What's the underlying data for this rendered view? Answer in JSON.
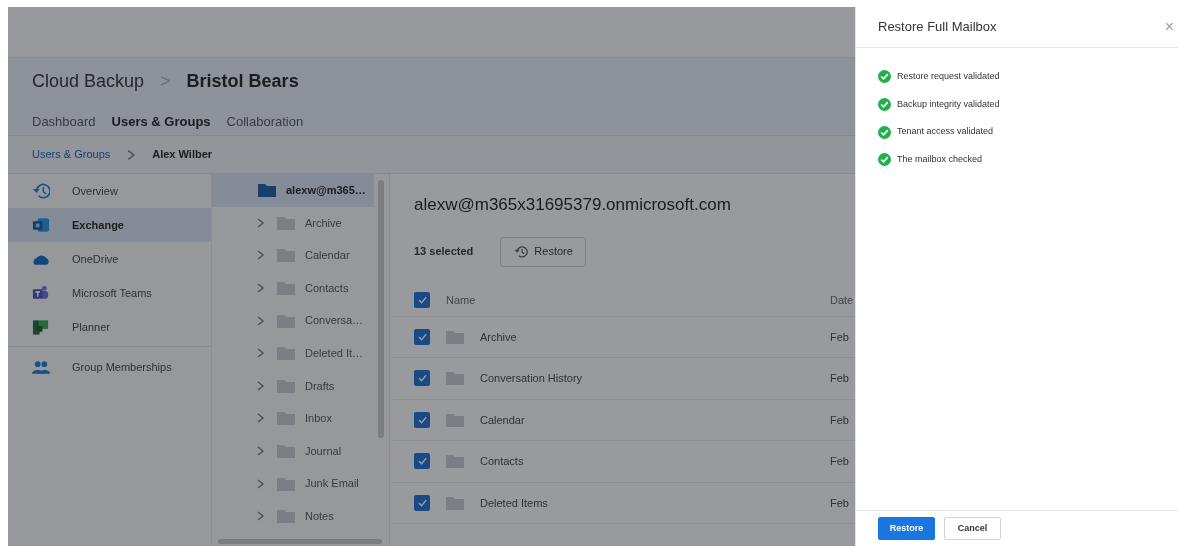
{
  "header": {
    "product": "Cloud Backup",
    "separator": ">",
    "organization": "Bristol Bears"
  },
  "tabs": [
    {
      "label": "Dashboard",
      "selected": false
    },
    {
      "label": "Users & Groups",
      "selected": true
    },
    {
      "label": "Collaboration",
      "selected": false
    }
  ],
  "breadcrumb": [
    {
      "label": "Users & Groups",
      "kind": "link"
    },
    {
      "label": "Alex Wilber",
      "kind": "current"
    }
  ],
  "sidebar": {
    "sections": [
      {
        "items": [
          {
            "label": "Overview",
            "kind": "history",
            "selected": false
          },
          {
            "label": "Exchange",
            "kind": "exchange",
            "selected": true
          },
          {
            "label": "OneDrive",
            "kind": "cloud",
            "selected": false
          },
          {
            "label": "Microsoft Teams",
            "kind": "teams",
            "selected": false
          },
          {
            "label": "Planner",
            "kind": "planner",
            "selected": false
          }
        ]
      },
      {
        "items": [
          {
            "label": "Group Memberships",
            "kind": "people",
            "selected": false
          }
        ]
      }
    ]
  },
  "folder_tree": {
    "root": {
      "label": "alexw@m365…",
      "selected": true
    },
    "children": [
      {
        "label": "Archive",
        "expanded": false
      },
      {
        "label": "Calendar",
        "expanded": false
      },
      {
        "label": "Contacts",
        "expanded": false
      },
      {
        "label": "Conversa…",
        "expanded": false
      },
      {
        "label": "Deleted It…",
        "expanded": false
      },
      {
        "label": "Drafts",
        "expanded": false
      },
      {
        "label": "Inbox",
        "expanded": false
      },
      {
        "label": "Journal",
        "expanded": false
      },
      {
        "label": "Junk Email",
        "expanded": false
      },
      {
        "label": "Notes",
        "expanded": false
      }
    ]
  },
  "content": {
    "title": "alexw@m365x31695379.onmicrosoft.com",
    "selection_count": "13 selected",
    "restore_button": "Restore",
    "table": {
      "all_checked": true,
      "columns": [
        "Name",
        "Date"
      ],
      "rows": [
        {
          "name": "Archive",
          "date": "Feb",
          "checked": true
        },
        {
          "name": "Conversation History",
          "date": "Feb",
          "checked": true
        },
        {
          "name": "Calendar",
          "date": "Feb",
          "checked": true
        },
        {
          "name": "Contacts",
          "date": "Feb",
          "checked": true
        },
        {
          "name": "Deleted Items",
          "date": "Feb",
          "checked": true
        }
      ]
    }
  },
  "drawer": {
    "title": "Restore Full Mailbox",
    "close": "×",
    "steps": [
      {
        "label": "Restore request validated",
        "done": true
      },
      {
        "label": "Backup integrity validated",
        "done": true
      },
      {
        "label": "Tenant access validated",
        "done": true
      },
      {
        "label": "The mailbox checked",
        "done": true
      }
    ],
    "buttons": [
      {
        "label": "Restore",
        "kind": "primary"
      },
      {
        "label": "Cancel",
        "kind": "secondary"
      }
    ]
  }
}
